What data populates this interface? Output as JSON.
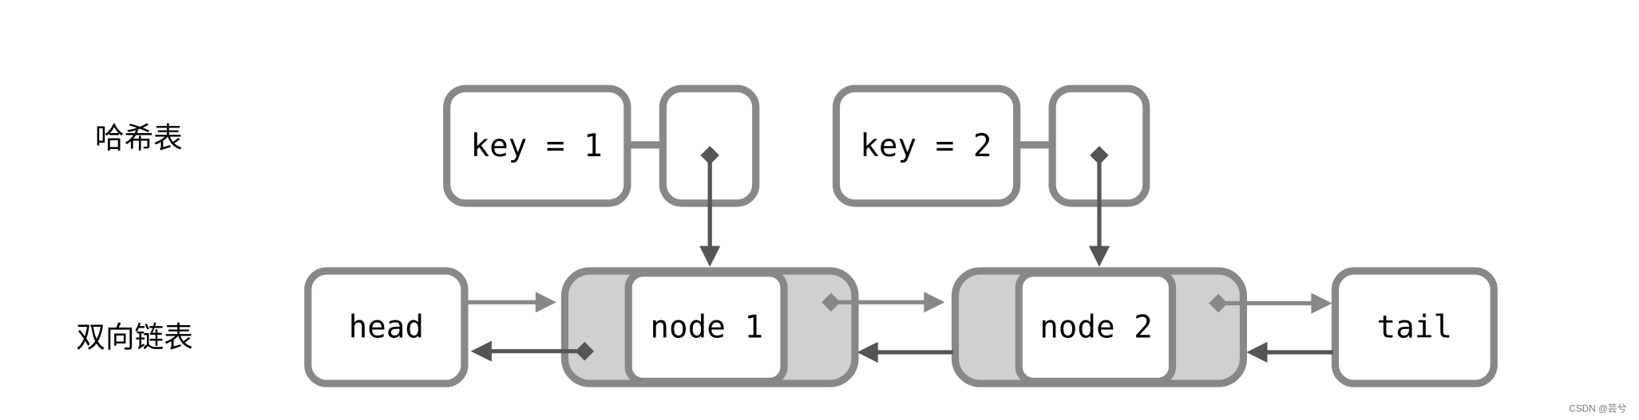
{
  "labels": {
    "hash_table": "哈希表",
    "doubly_linked_list": "双向链表"
  },
  "hash_entries": [
    {
      "key_label": "key = 1"
    },
    {
      "key_label": "key = 2"
    }
  ],
  "list_nodes": {
    "head": "head",
    "node1": "node 1",
    "node2": "node 2",
    "tail": "tail"
  },
  "watermark": "CSDN @芸兮",
  "colors": {
    "border": "#888888",
    "node_fill": "#d0d0d0",
    "dark_arrow": "#555555",
    "light_arrow": "#888888"
  }
}
